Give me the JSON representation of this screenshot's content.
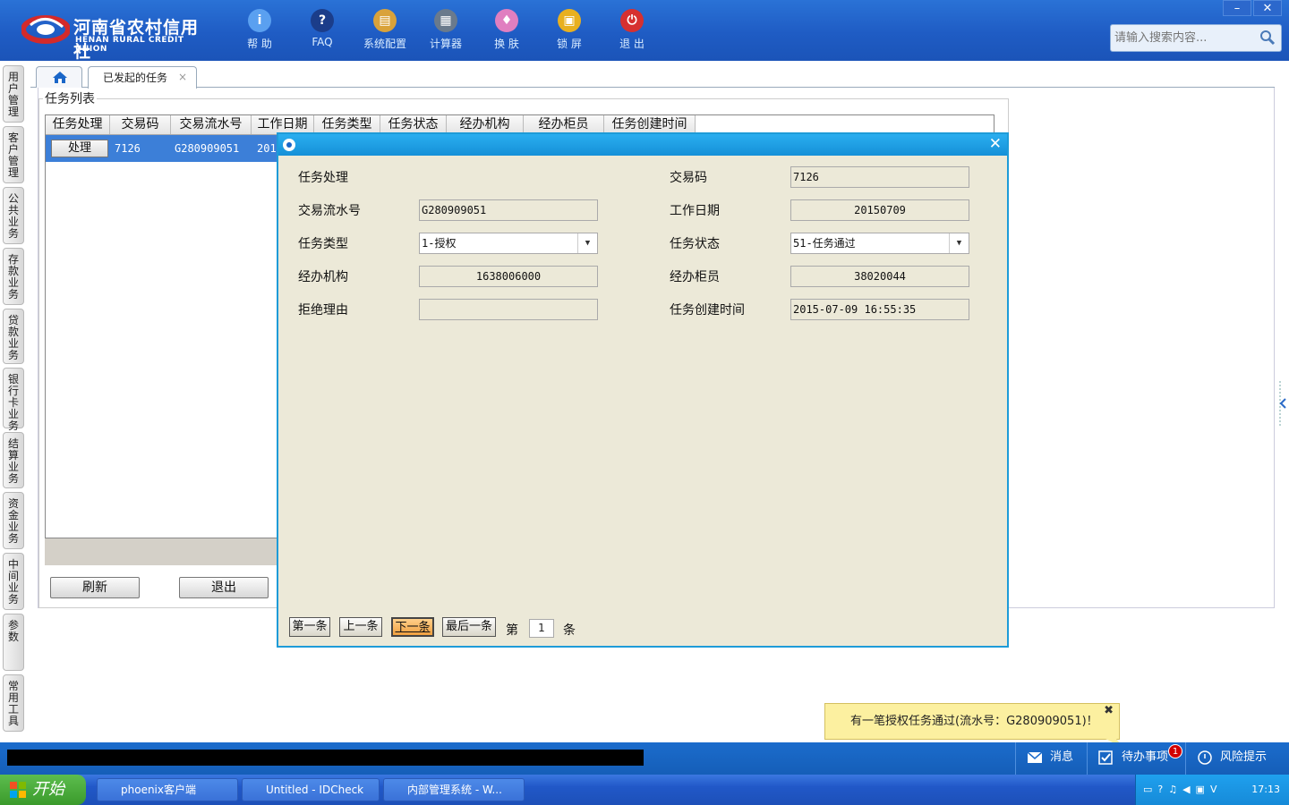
{
  "app": {
    "logo_cn": "河南省农村信用社",
    "logo_en": "HENAN RURAL CREDIT UNION"
  },
  "toolbar": [
    {
      "label": "帮 助",
      "icon": "info-icon",
      "glyph": "i",
      "color": "#5aa0f0"
    },
    {
      "label": "FAQ",
      "icon": "question-icon",
      "glyph": "?",
      "color": "#1b3d8a"
    },
    {
      "label": "系统配置",
      "icon": "toolbox-icon",
      "glyph": "▤",
      "color": "#d9a23a"
    },
    {
      "label": "计算器",
      "icon": "calculator-icon",
      "glyph": "▦",
      "color": "#6a7a8c"
    },
    {
      "label": "换 肤",
      "icon": "shirt-icon",
      "glyph": "♦",
      "color": "#e07fc0"
    },
    {
      "label": "锁 屏",
      "icon": "lock-icon",
      "glyph": "▣",
      "color": "#e8b020"
    },
    {
      "label": "退 出",
      "icon": "power-icon",
      "glyph": "⏻",
      "color": "#d63030"
    }
  ],
  "search": {
    "placeholder": "请输入搜索内容..."
  },
  "window_controls": {
    "minimize": "–",
    "close": "✕"
  },
  "leftnav": [
    "用户管理",
    "客户管理",
    "公共业务",
    "存款业务",
    "贷款业务",
    "银行卡业务",
    "结算业务",
    "资金业务",
    "中间业务",
    "参数",
    "常用工具"
  ],
  "tabs": {
    "active": "已发起的任务",
    "close": "×"
  },
  "task_list": {
    "title": "任务列表",
    "columns": [
      "任务处理",
      "交易码",
      "交易流水号",
      "工作日期",
      "任务类型",
      "任务状态",
      "经办机构",
      "经办柜员",
      "任务创建时间"
    ],
    "rows": [
      {
        "action": "处理",
        "code": "7126",
        "serial": "G280909051",
        "date": "201"
      }
    ],
    "refresh": "刷新",
    "exit": "退出"
  },
  "dialog": {
    "close": "✕",
    "fields": {
      "task_process": "任务处理",
      "trade_code_label": "交易码",
      "trade_code": "7126",
      "serial_label": "交易流水号",
      "serial": "G280909051",
      "work_date_label": "工作日期",
      "work_date": "20150709",
      "task_type_label": "任务类型",
      "task_type": "1-授权",
      "task_status_label": "任务状态",
      "task_status": "51-任务通过",
      "org_label": "经办机构",
      "org": "1638006000",
      "teller_label": "经办柜员",
      "teller": "38020044",
      "reject_label": "拒绝理由",
      "reject": "",
      "create_time_label": "任务创建时间",
      "create_time": "2015-07-09 16:55:35"
    },
    "nav": {
      "first": "第一条",
      "prev": "上一条",
      "next": "下一条",
      "last": "最后一条",
      "page_prefix": "第",
      "page": "1",
      "page_suffix": "条"
    }
  },
  "toast": {
    "message": "有一笔授权任务通过(流水号：G280909051)！",
    "close": "✖"
  },
  "statusbar": {
    "messages": "消息",
    "todo": "待办事项",
    "todo_count": "1",
    "risk": "风险提示"
  },
  "taskbar": {
    "start": "开始",
    "items": [
      "phoenix客户端",
      "Untitled - IDCheck",
      "内部管理系统 - W..."
    ],
    "clock": "17:13"
  }
}
